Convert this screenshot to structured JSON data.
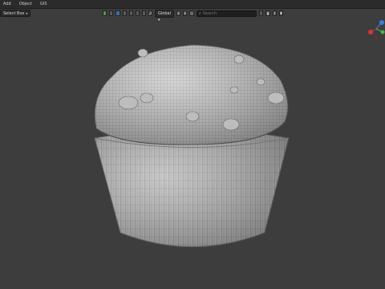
{
  "menu": {
    "items": [
      "Add",
      "Object",
      "GIS"
    ]
  },
  "select_mode": {
    "label": "Select Box"
  },
  "toolbar": {
    "transform_orientation": "Global",
    "search_placeholder": "Search"
  },
  "colors": {
    "background": "#3d3d3d",
    "mesh": "#c9c9c9",
    "wire": "#6f6f6f",
    "accent": "#3f6ea8"
  },
  "icons": [
    "checkbox-icon",
    "select-mode-icon",
    "orientation-icon",
    "pivot-icon",
    "snap-icon",
    "proportional-icon",
    "filter-icon",
    "view-gizmo-icon"
  ]
}
